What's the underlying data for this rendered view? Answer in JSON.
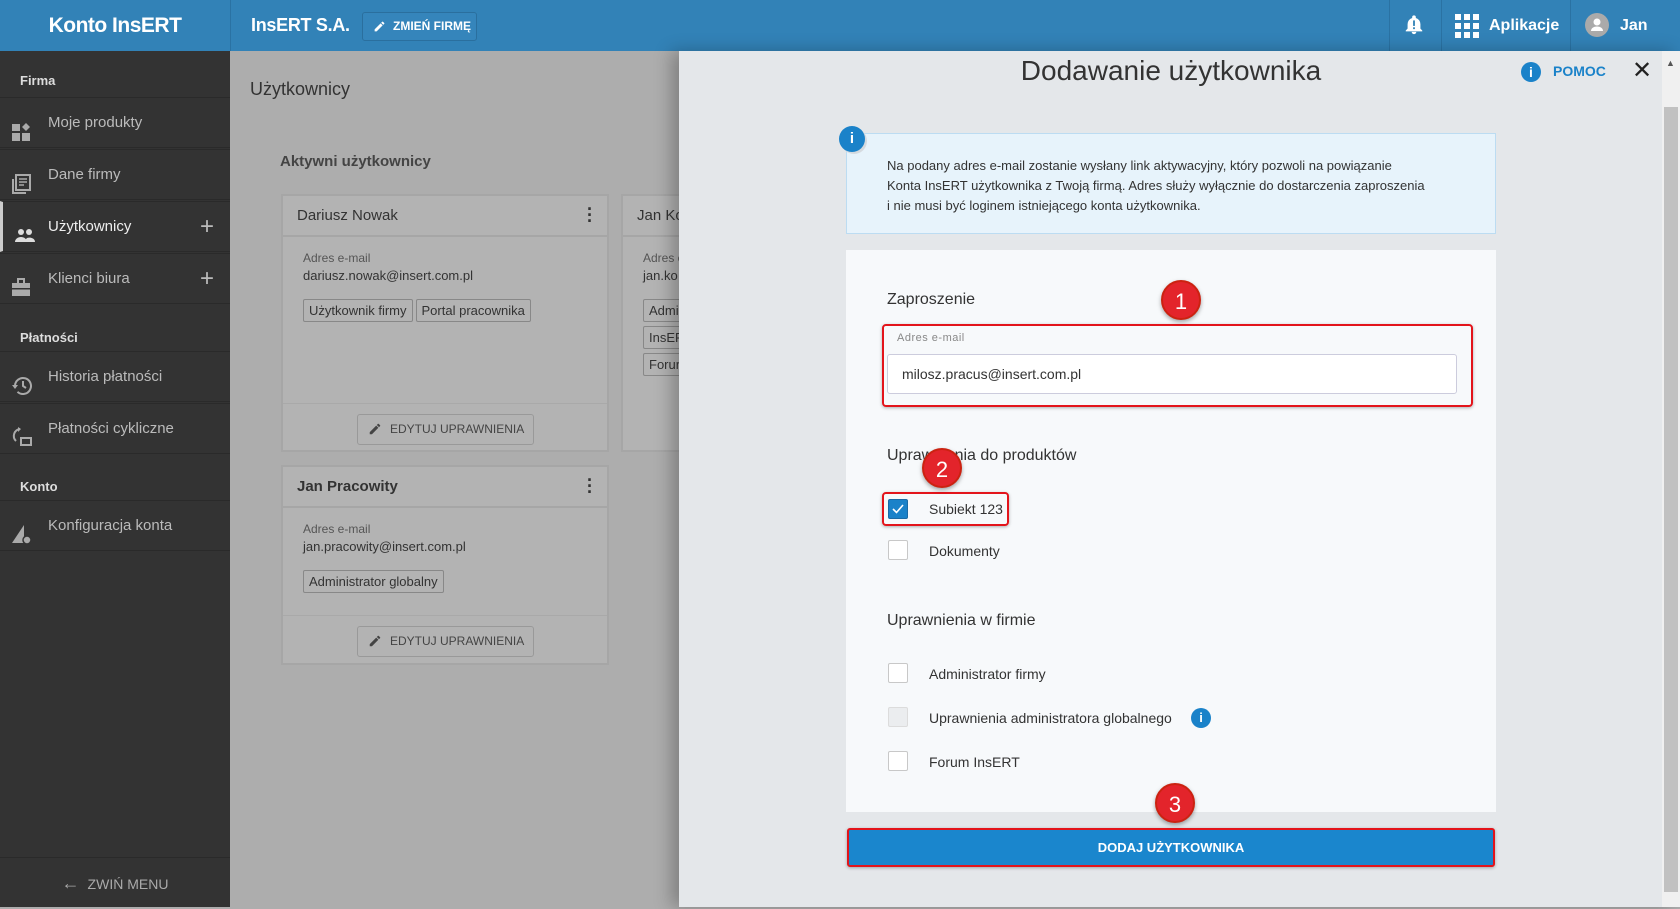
{
  "header": {
    "logo": "Konto InsERT",
    "company": "InsERT S.A.",
    "change_company": "ZMIEŃ FIRMĘ",
    "apps": "Aplikacje",
    "user": "Jan"
  },
  "sidebar": {
    "sections": [
      "Firma",
      "Płatności",
      "Konto"
    ],
    "items": [
      {
        "label": "Moje produkty"
      },
      {
        "label": "Dane firmy"
      },
      {
        "label": "Użytkownicy",
        "active": true
      },
      {
        "label": "Klienci biura"
      },
      {
        "label": "Historia płatności"
      },
      {
        "label": "Płatności cykliczne"
      },
      {
        "label": "Konfiguracja konta"
      }
    ],
    "collapse": "ZWIŃ MENU"
  },
  "main": {
    "title": "Użytkownicy",
    "subtitle": "Aktywni użytkownicy",
    "cards": [
      {
        "name": "Dariusz Nowak",
        "email_label": "Adres e-mail",
        "email": "dariusz.nowak@insert.com.pl",
        "tags": [
          "Użytkownik firmy",
          "Portal pracownika"
        ],
        "edit": "EDYTUJ UPRAWNIENIA"
      },
      {
        "name": "Jan Ko",
        "email_label": "Adres e",
        "email": "jan.ko",
        "tags": [
          "Admi",
          "InsER",
          "Forur"
        ]
      },
      {
        "name": "Jan Pracowity",
        "email_label": "Adres e-mail",
        "email": "jan.pracowity@insert.com.pl",
        "tags": [
          "Administrator globalny"
        ],
        "edit": "EDYTUJ UPRAWNIENIA"
      }
    ]
  },
  "panel": {
    "title": "Dodawanie użytkownika",
    "help": "POMOC",
    "info": [
      "Na podany adres e-mail zostanie wysłany link aktywacyjny, który pozwoli na powiązanie",
      "Konta InsERT użytkownika z Twoją firmą. Adres służy wyłącznie do dostarczenia zaproszenia",
      "i nie musi być loginem istniejącego konta użytkownika."
    ],
    "invite_heading": "Zaproszenie",
    "email_label": "Adres e-mail",
    "email_value": "milosz.pracus@insert.com.pl",
    "products_heading": "Uprawnienia do produktów",
    "products": [
      {
        "label": "Subiekt 123",
        "checked": true
      },
      {
        "label": "Dokumenty",
        "checked": false
      }
    ],
    "company_heading": "Uprawnienia w firmie",
    "company_perms": [
      {
        "label": "Administrator firmy",
        "checked": false
      },
      {
        "label": "Uprawnienia administratora globalnego",
        "checked": false,
        "disabled": true
      },
      {
        "label": "Forum InsERT",
        "checked": false
      }
    ],
    "submit": "DODAJ UŻYTKOWNIKA"
  },
  "annotations": [
    "1",
    "2",
    "3"
  ]
}
